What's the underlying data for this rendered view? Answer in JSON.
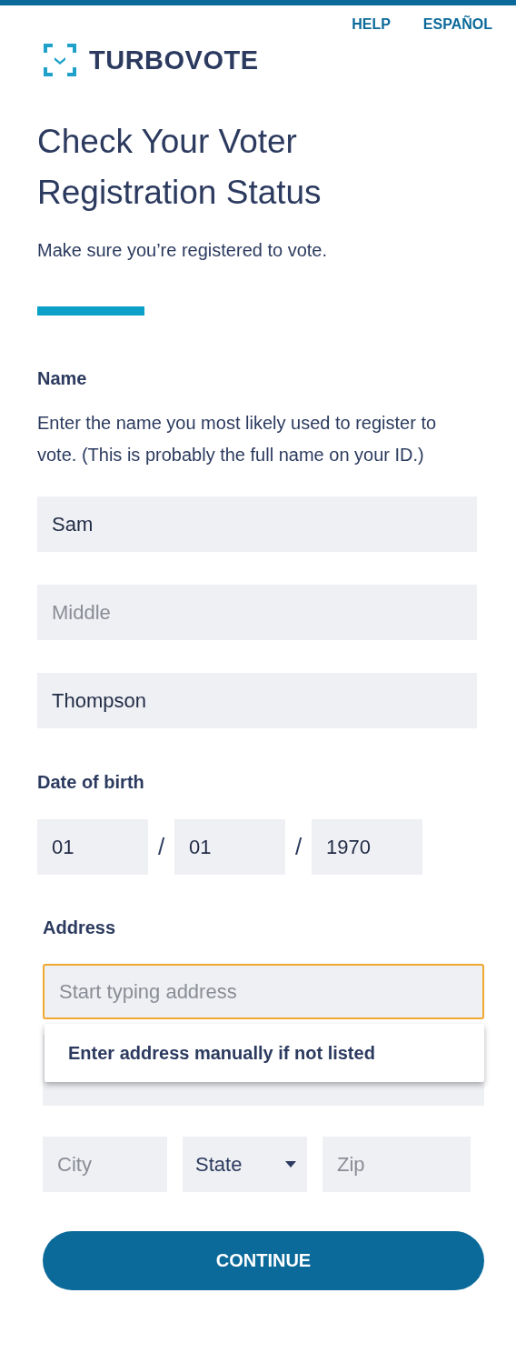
{
  "header": {
    "logo": "TURBOVOTE",
    "links": [
      "HELP",
      "ESPAÑOL"
    ]
  },
  "title": "Check Your Voter Registration Status",
  "subtitle": "Make sure you’re registered to vote.",
  "name_section": {
    "label": "Name",
    "description": "Enter the name you most likely used to register to vote. (This is probably the full name on your ID.)",
    "fields": [
      {
        "value": "Sam"
      },
      {
        "placeholder": "Middle"
      },
      {
        "value": "Thompson"
      }
    ]
  },
  "dob": {
    "label": "Date of birth",
    "fields": [
      {
        "value": "01"
      },
      {
        "value": "01"
      },
      {
        "value": "1970"
      }
    ],
    "separators": [
      "/",
      "/"
    ]
  },
  "address": {
    "label": "Address",
    "street": {
      "placeholder": "Start typing address",
      "focused": true
    },
    "suggestions": [
      "Enter address manually if not listed"
    ],
    "city": {
      "placeholder": "City"
    },
    "state": {
      "value": "State"
    },
    "zip": {
      "placeholder": "Zip"
    }
  },
  "continue_button": "CONTINUE"
}
